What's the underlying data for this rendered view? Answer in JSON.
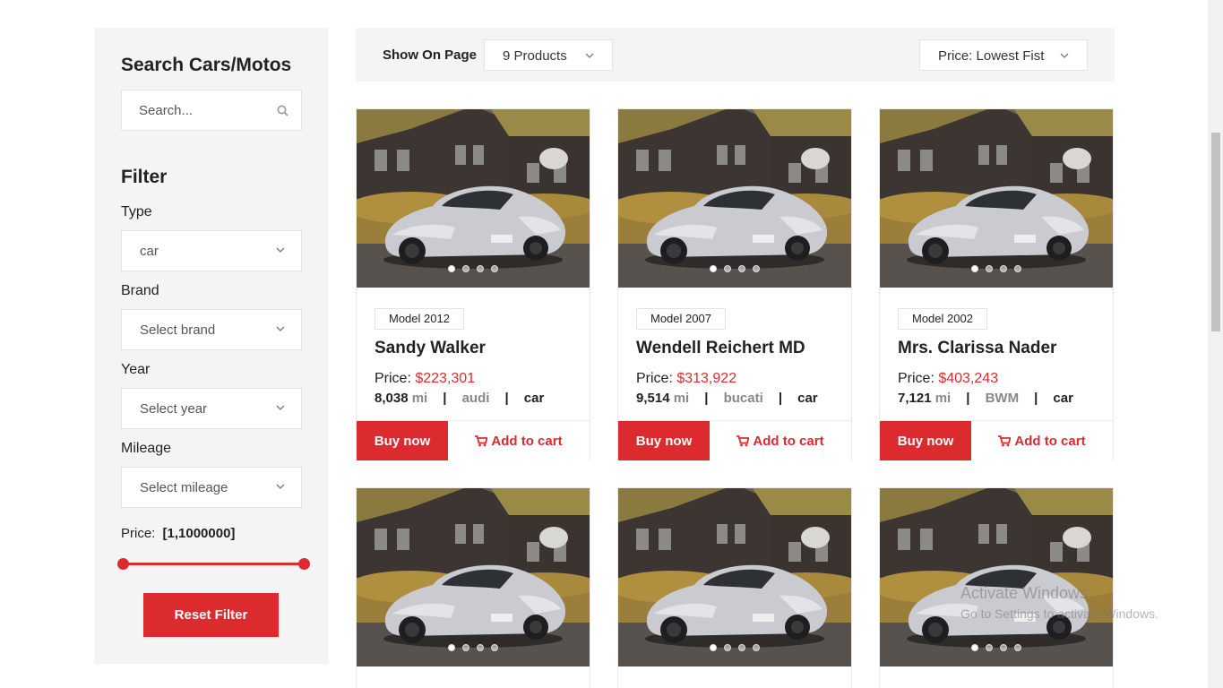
{
  "sidebar": {
    "title": "Search Cars/Motos",
    "search_placeholder": "Search...",
    "filter_title": "Filter",
    "type_label": "Type",
    "type_value": "car",
    "brand_label": "Brand",
    "brand_placeholder": "Select brand",
    "year_label": "Year",
    "year_placeholder": "Select year",
    "mileage_label": "Mileage",
    "mileage_placeholder": "Select mileage",
    "price_label": "Price:",
    "price_range": "[1,1000000]",
    "reset_label": "Reset Filter"
  },
  "toolbar": {
    "show_label": "Show On Page",
    "per_page_value": "9 Products",
    "sort_value": "Price: Lowest Fist"
  },
  "cards": [
    {
      "model": "Model 2012",
      "name": "Sandy Walker",
      "price_label": "Price:",
      "price": "$223,301",
      "mileage": "8,038",
      "unit": "mi",
      "brand": "audi",
      "type": "car",
      "buy": "Buy now",
      "cart": "Add to cart"
    },
    {
      "model": "Model 2007",
      "name": "Wendell Reichert MD",
      "price_label": "Price:",
      "price": "$313,922",
      "mileage": "9,514",
      "unit": "mi",
      "brand": "bucati",
      "type": "car",
      "buy": "Buy now",
      "cart": "Add to cart"
    },
    {
      "model": "Model 2002",
      "name": "Mrs. Clarissa Nader",
      "price_label": "Price:",
      "price": "$403,243",
      "mileage": "7,121",
      "unit": "mi",
      "brand": "BWM",
      "type": "car",
      "buy": "Buy now",
      "cart": "Add to cart"
    }
  ],
  "watermark": {
    "line1": "Activate Windows",
    "line2": "Go to Settings to activate Windows."
  },
  "colors": {
    "accent": "#dc2b2f",
    "panel": "#f4f4f4"
  }
}
